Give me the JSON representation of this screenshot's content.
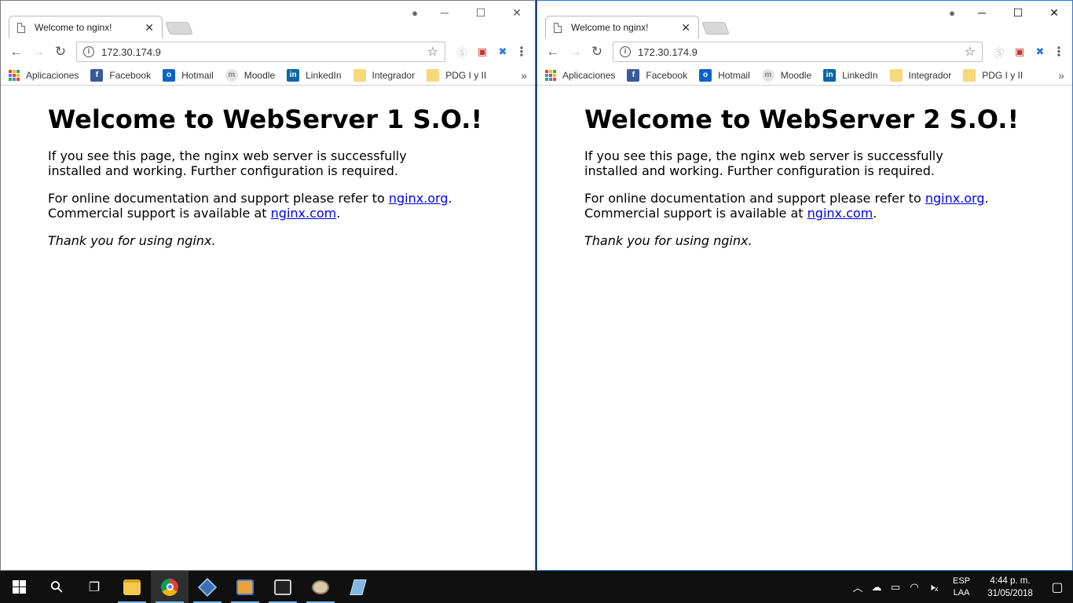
{
  "windows": [
    {
      "tab_title": "Welcome to nginx!",
      "url": "172.30.174.9",
      "heading": "Welcome to WebServer 1 S.O.!",
      "p1": "If you see this page, the nginx web server is successfully installed and working. Further configuration is required.",
      "p2_pre": "For online documentation and support please refer to ",
      "p2_link1": "nginx.org",
      "p2_mid": ". Commercial support is available at ",
      "p2_link2": "nginx.com",
      "p2_post": ".",
      "p3": "Thank you for using nginx."
    },
    {
      "tab_title": "Welcome to nginx!",
      "url": "172.30.174.9",
      "heading": "Welcome to WebServer 2 S.O.!",
      "p1": "If you see this page, the nginx web server is successfully installed and working. Further configuration is required.",
      "p2_pre": "For online documentation and support please refer to ",
      "p2_link1": "nginx.org",
      "p2_mid": ". Commercial support is available at ",
      "p2_link2": "nginx.com",
      "p2_post": ".",
      "p3": "Thank you for using nginx."
    }
  ],
  "bookmarks": {
    "apps": "Aplicaciones",
    "facebook": "Facebook",
    "hotmail": "Hotmail",
    "moodle": "Moodle",
    "linkedin": "LinkedIn",
    "integrador": "Integrador",
    "pdg": "PDG I y II",
    "more": "»"
  },
  "icons": {
    "minimize": "─",
    "maximize": "☐",
    "close": "✕",
    "tab_close": "✕",
    "back": "←",
    "forward": "→",
    "reload": "↻",
    "star": "☆",
    "menu": "⋮",
    "user": "●",
    "search": "⚲",
    "task_view": "❐",
    "tray_up": "︿",
    "cloud": "☁",
    "battery": "▭",
    "wifi": "◠",
    "volume": "🔇",
    "notifications": "▢"
  },
  "taskbar": {
    "lang_top": "ESP",
    "lang_bottom": "LAA",
    "time": "4:44 p. m.",
    "date": "31/05/2018"
  }
}
